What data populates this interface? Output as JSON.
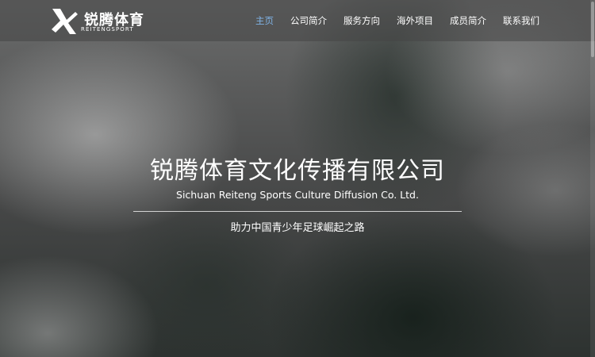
{
  "brand": {
    "name_cn": "锐腾体育",
    "name_en": "REITENGSPORT"
  },
  "nav": {
    "items": [
      {
        "label": "主页",
        "active": true
      },
      {
        "label": "公司简介",
        "active": false
      },
      {
        "label": "服务方向",
        "active": false
      },
      {
        "label": "海外项目",
        "active": false
      },
      {
        "label": "成员简介",
        "active": false
      },
      {
        "label": "联系我们",
        "active": false
      }
    ],
    "active_color": "#7fb2e5"
  },
  "hero": {
    "title": "锐腾体育文化传播有限公司",
    "subtitle": "Sichuan Reiteng Sports Culture Diffusion Co. Ltd.",
    "slogan": "助力中国青少年足球崛起之路"
  }
}
